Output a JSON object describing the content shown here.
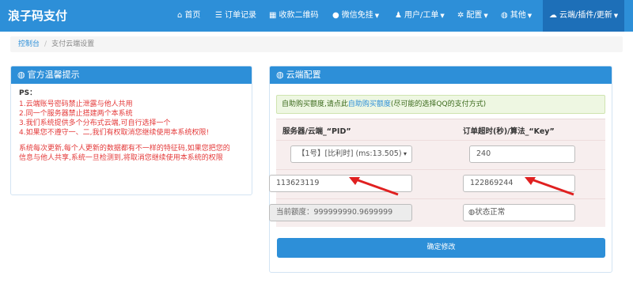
{
  "nav": {
    "brand": "浪子码支付",
    "items": [
      {
        "icon": "home-icon",
        "label": "首页"
      },
      {
        "icon": "list-icon",
        "label": "订单记录"
      },
      {
        "icon": "qrcode-icon",
        "label": "收款二维码"
      },
      {
        "icon": "wechat-icon",
        "label": "微信免挂"
      },
      {
        "icon": "user-icon",
        "label": "用户/工单"
      },
      {
        "icon": "gear-icon",
        "label": "配置"
      },
      {
        "icon": "globe-icon",
        "label": "其他"
      },
      {
        "icon": "cloud-icon",
        "label": "云端/插件/更新"
      }
    ]
  },
  "breadcrumb": {
    "root": "控制台",
    "separator": "/",
    "current": "支付云端设置"
  },
  "left_panel": {
    "title": "官方温馨提示",
    "ps": "PS：",
    "lines": [
      "1.云端账号密码禁止泄露与他人共用",
      "2.同一个服务器禁止搭建两个本系统",
      "3.我们系统提供多个分布式云端,可自行选择一个",
      "4.如果您不遵守一、二,我们有权取消您继续使用本系统权限!"
    ],
    "note_lines": [
      "系统每次更新,每个人更新的数据都有不一样的特征码,如果您把您的",
      "信息与他人共享,系统一旦检测到,将取消您继续使用本系统的权限"
    ]
  },
  "right_panel": {
    "title": "云端配置",
    "alert_prefix": "自助购买额度,请点此",
    "alert_link": "自助购买额度",
    "alert_suffix": "(尽可能的选择QQ的支付方式)",
    "col_left": "服务器/云端_“PID”",
    "col_right": "订单超时(秒)/算法_“Key”",
    "server_select": "【1号】[比利时] (ms:13.505)",
    "timeout": "240",
    "pid": "113623119",
    "key": "122869244",
    "quota": "当前额度：999999990.9699999",
    "status_label": "状态正常",
    "submit": "确定修改"
  },
  "colors": {
    "primary": "#2d8fd8",
    "danger": "#e43a3a",
    "arrow": "#e02020"
  }
}
